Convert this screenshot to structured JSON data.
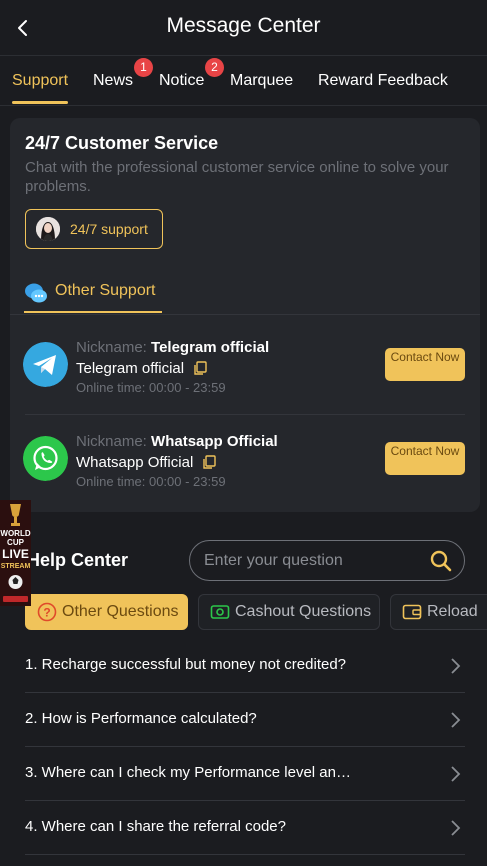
{
  "header": {
    "title": "Message Center"
  },
  "tabs": [
    {
      "label": "Support",
      "badge": ""
    },
    {
      "label": "News",
      "badge": "1"
    },
    {
      "label": "Notice",
      "badge": "2"
    },
    {
      "label": "Marquee",
      "badge": ""
    },
    {
      "label": "Reward Feedback",
      "badge": ""
    }
  ],
  "service": {
    "title": "24/7 Customer Service",
    "description": "Chat with the professional customer service online to solve your problems.",
    "button_label": "24/7 support"
  },
  "other_support": {
    "label": "Other Support",
    "contacts": [
      {
        "nickname_label": "Nickname:",
        "nickname": "Telegram official",
        "name": "Telegram official",
        "online": "Online time: 00:00 - 23:59",
        "button": "Contact Now",
        "icon": "telegram-icon"
      },
      {
        "nickname_label": "Nickname:",
        "nickname": "Whatsapp Official",
        "name": "Whatsapp Official",
        "online": "Online time: 00:00 - 23:59",
        "button": "Contact Now",
        "icon": "whatsapp-icon"
      }
    ]
  },
  "help": {
    "title": "Help Center",
    "search_placeholder": "Enter your question",
    "categories": [
      {
        "label": "Other Questions",
        "icon": "question-icon"
      },
      {
        "label": "Cashout Questions",
        "icon": "cash-icon"
      },
      {
        "label": "Reload",
        "icon": "wallet-icon"
      }
    ],
    "questions": [
      "1. Recharge successful but money not credited?",
      "2. How is Performance calculated?",
      "3. Where can I check my Performance level an…",
      "4. Where can I share the referral code?"
    ]
  },
  "promo": {
    "label": "WORLD CUP LIVE STREAM"
  },
  "colors": {
    "accent": "#f0c35a",
    "background": "#1b1c20",
    "card": "#25272c",
    "badge": "#e84446"
  }
}
